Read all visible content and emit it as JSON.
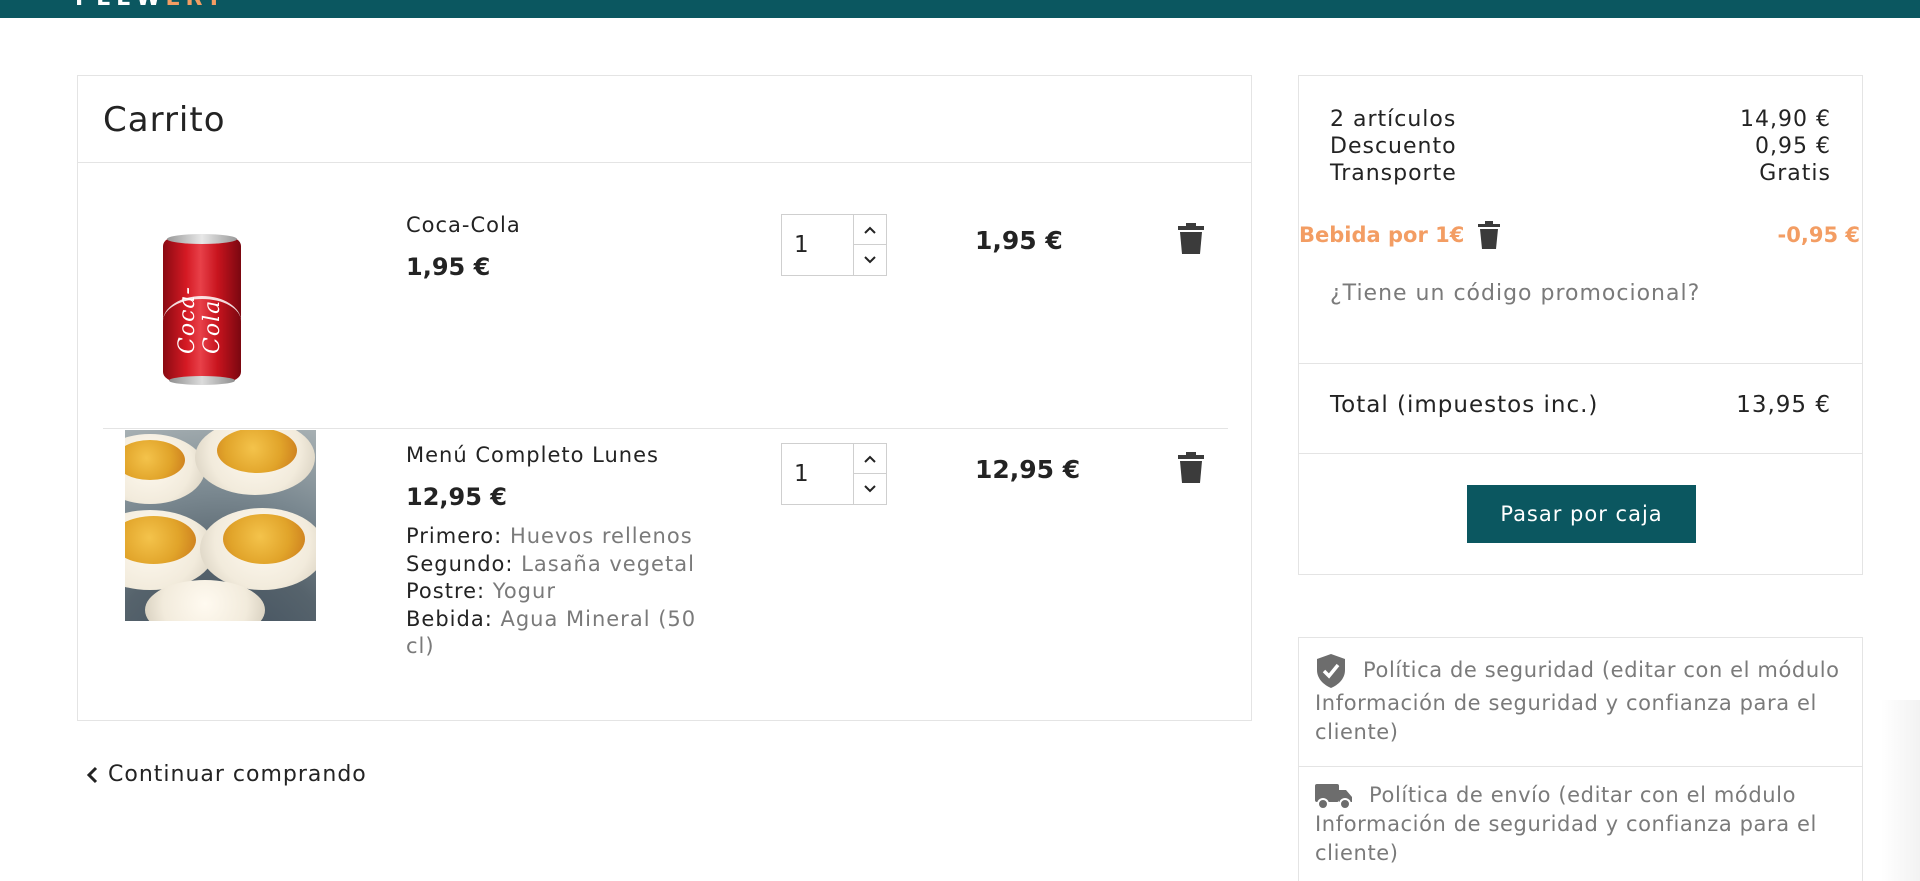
{
  "header": {
    "logo_main": "PEEW",
    "logo_accent": "ERT",
    "color": "#0b5760"
  },
  "cart": {
    "title": "Carrito",
    "items": [
      {
        "name": "Coca-Cola",
        "unit_price": "1,95 €",
        "quantity": "1",
        "total": "1,95 €",
        "image_icon": "coca-cola-can-image",
        "can_text": "Coca-Cola"
      },
      {
        "name": "Menú Completo Lunes",
        "unit_price": "12,95 €",
        "quantity": "1",
        "total": "12,95 €",
        "image_icon": "deviled-eggs-image",
        "attributes": [
          {
            "label": "Primero:",
            "value": "Huevos rellenos"
          },
          {
            "label": "Segundo:",
            "value": "Lasaña vegetal"
          },
          {
            "label": "Postre:",
            "value": "Yogur"
          },
          {
            "label": "Bebida:",
            "value": "Agua Mineral (50 cl)"
          }
        ]
      }
    ],
    "continue_label": "Continuar comprando"
  },
  "summary": {
    "items_label": "2 artículos",
    "items_value": "14,90 €",
    "discount_label": "Descuento",
    "discount_value": "0,95 €",
    "shipping_label": "Transporte",
    "shipping_value": "Gratis",
    "promo_name": "Bebida por 1€",
    "promo_value": "-0,95 €",
    "promo_code_link": "¿Tiene un código promocional?",
    "total_label": "Total (impuestos inc.)",
    "total_value": "13,95 €",
    "checkout_label": "Pasar por caja"
  },
  "reassurance": [
    {
      "icon": "shield-check-icon",
      "text": "Política de seguridad (editar con el módulo Información de seguridad y confianza para el cliente)"
    },
    {
      "icon": "truck-icon",
      "text": "Política de envío (editar con el módulo Información de seguridad y confianza para el cliente)"
    }
  ],
  "colors": {
    "accent": "#0b5760",
    "promo": "#f39d63",
    "muted": "#7a7a7a",
    "text": "#232323"
  }
}
